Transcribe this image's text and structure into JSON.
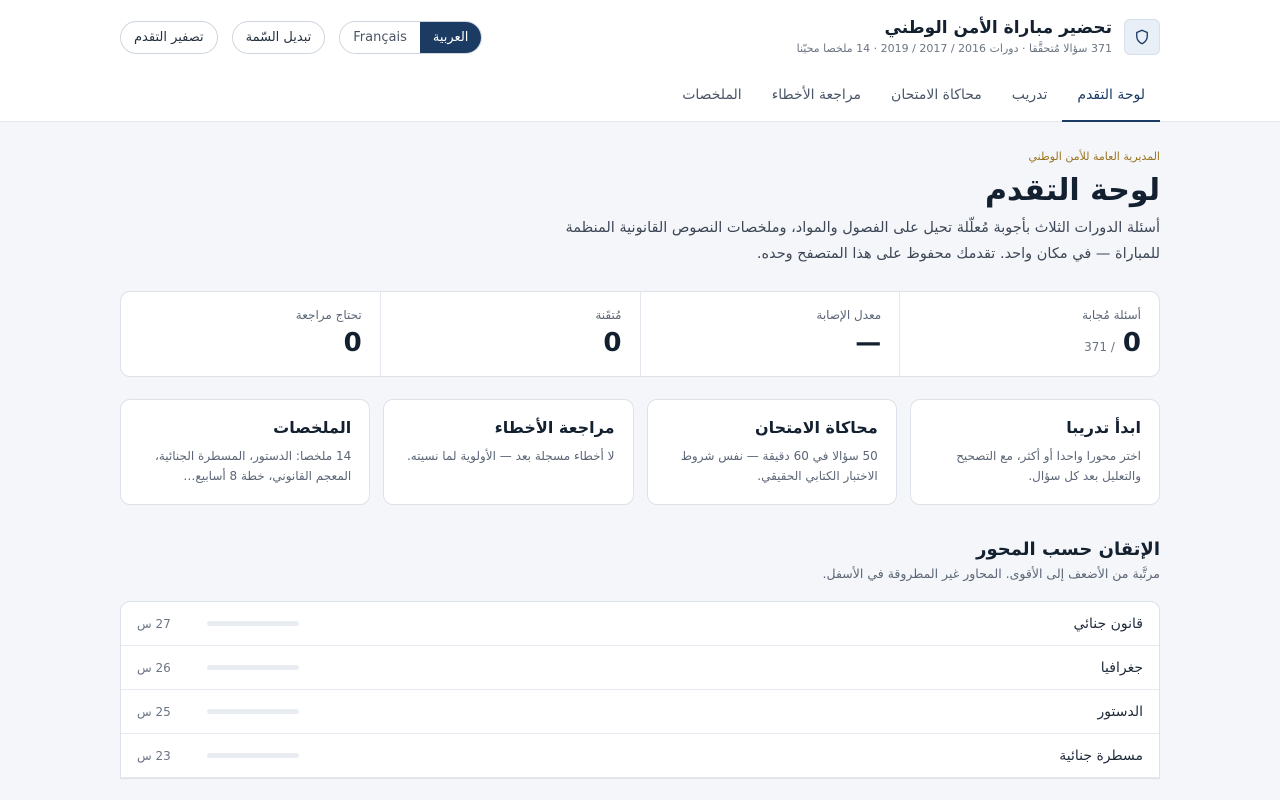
{
  "brand": {
    "title": "تحضير مباراة الأمن الوطني",
    "subtitle": "371 سؤالا مُتحقَّقا · دورات 2016 / 2017 / 2019 · 14 ملخصا محيّنا",
    "logo_icon": "shield-icon"
  },
  "actions": {
    "reset": "تصفير التقدم",
    "theme": "تبديل السّمة",
    "lang_ar": "العربية",
    "lang_fr": "Français"
  },
  "tabs": [
    {
      "label": "لوحة التقدم"
    },
    {
      "label": "تدريب"
    },
    {
      "label": "محاكاة الامتحان"
    },
    {
      "label": "مراجعة الأخطاء"
    },
    {
      "label": "الملخصات"
    }
  ],
  "page": {
    "org": "المديرية العامة للأمن الوطني",
    "title": "لوحة التقدم",
    "intro": "أسئلة الدورات الثلاث بأجوبة مُعلّلة تحيل على الفصول والمواد، وملخصات النصوص القانونية المنظمة للمباراة — في مكان واحد. تقدمك محفوظ على هذا المتصفح وحده."
  },
  "stats": [
    {
      "label": "أسئلة مُجابة",
      "value": "0",
      "sub": "/ 371"
    },
    {
      "label": "معدل الإصابة",
      "value": "—",
      "sub": ""
    },
    {
      "label": "مُتقَنة",
      "value": "0",
      "sub": ""
    },
    {
      "label": "تحتاج مراجعة",
      "value": "0",
      "sub": ""
    }
  ],
  "cards": [
    {
      "title": "ابدأ تدريبا",
      "desc": "اختر محورا واحدا أو أكثر، مع التصحيح والتعليل بعد كل سؤال."
    },
    {
      "title": "محاكاة الامتحان",
      "desc": "50 سؤالا في 60 دقيقة — نفس شروط الاختبار الكتابي الحقيقي."
    },
    {
      "title": "مراجعة الأخطاء",
      "desc": "لا أخطاء مسجلة بعد — الأولوية لما نسيته."
    },
    {
      "title": "الملخصات",
      "desc": "14 ملخصا: الدستور، المسطرة الجنائية، المعجم القانوني، خطة 8 أسابيع…"
    }
  ],
  "mastery": {
    "title": "الإتقان حسب المحور",
    "subtitle": "مرتَّبة من الأضعف إلى الأقوى. المحاور غير المطروقة في الأسفل.",
    "rows": [
      {
        "name": "قانون جنائي",
        "count": "27 س",
        "progress": 0
      },
      {
        "name": "جغرافيا",
        "count": "26 س",
        "progress": 0
      },
      {
        "name": "الدستور",
        "count": "25 س",
        "progress": 0
      },
      {
        "name": "مسطرة جنائية",
        "count": "23 س",
        "progress": 0
      }
    ]
  }
}
